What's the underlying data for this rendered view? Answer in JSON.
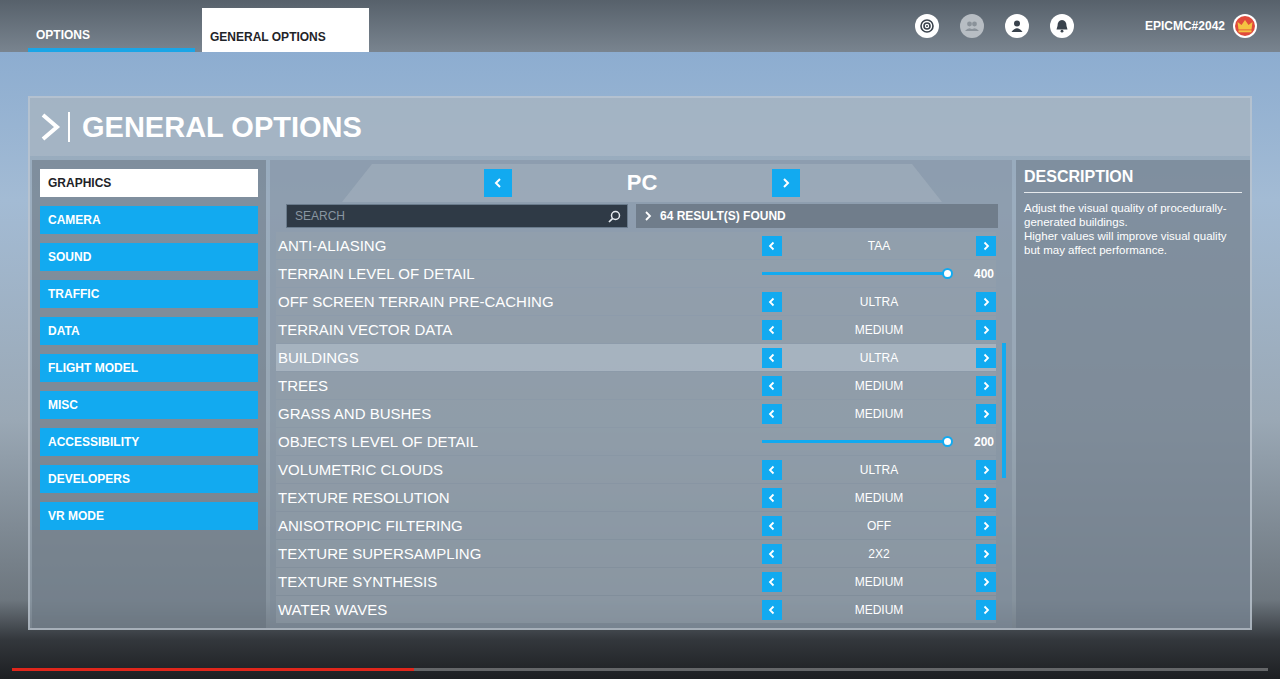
{
  "top_bar": {
    "tabs": [
      {
        "label": "OPTIONS",
        "selected": false
      },
      {
        "label": "GENERAL OPTIONS",
        "selected": true
      }
    ],
    "icons": [
      {
        "disabled": false
      },
      {
        "disabled": true
      },
      {
        "disabled": false
      },
      {
        "disabled": false
      }
    ],
    "username": "EPICMC#2042"
  },
  "panel": {
    "title": "GENERAL OPTIONS"
  },
  "sidebar": {
    "items": [
      {
        "label": "GRAPHICS",
        "selected": true
      },
      {
        "label": "CAMERA",
        "selected": false
      },
      {
        "label": "SOUND",
        "selected": false
      },
      {
        "label": "TRAFFIC",
        "selected": false
      },
      {
        "label": "DATA",
        "selected": false
      },
      {
        "label": "FLIGHT MODEL",
        "selected": false
      },
      {
        "label": "MISC",
        "selected": false
      },
      {
        "label": "ACCESSIBILITY",
        "selected": false
      },
      {
        "label": "DEVELOPERS",
        "selected": false
      },
      {
        "label": "VR MODE",
        "selected": false
      }
    ]
  },
  "platform": {
    "label": "PC"
  },
  "search": {
    "placeholder": "SEARCH",
    "results": "64 RESULT(S) FOUND"
  },
  "settings": [
    {
      "label": "ANTI-ALIASING",
      "kind": "select",
      "value": "TAA",
      "selected": false
    },
    {
      "label": "TERRAIN LEVEL OF DETAIL",
      "kind": "slider",
      "level": 1,
      "value": "400",
      "selected": false
    },
    {
      "label": "OFF SCREEN TERRAIN PRE-CACHING",
      "kind": "select",
      "value": "ULTRA",
      "selected": false
    },
    {
      "label": "TERRAIN VECTOR DATA",
      "kind": "select",
      "value": "MEDIUM",
      "selected": false
    },
    {
      "label": "BUILDINGS",
      "kind": "select",
      "value": "ULTRA",
      "selected": true
    },
    {
      "label": "TREES",
      "kind": "select",
      "value": "MEDIUM",
      "selected": false
    },
    {
      "label": "GRASS AND BUSHES",
      "kind": "select",
      "value": "MEDIUM",
      "selected": false
    },
    {
      "label": "OBJECTS LEVEL OF DETAIL",
      "kind": "slider",
      "level": 1,
      "value": "200",
      "selected": false
    },
    {
      "label": "VOLUMETRIC CLOUDS",
      "kind": "select",
      "value": "ULTRA",
      "selected": false
    },
    {
      "label": "TEXTURE RESOLUTION",
      "kind": "select",
      "value": "MEDIUM",
      "selected": false
    },
    {
      "label": "ANISOTROPIC FILTERING",
      "kind": "select",
      "value": "OFF",
      "selected": false
    },
    {
      "label": "TEXTURE SUPERSAMPLING",
      "kind": "select",
      "value": "2X2",
      "selected": false
    },
    {
      "label": "TEXTURE SYNTHESIS",
      "kind": "select",
      "value": "MEDIUM",
      "selected": false
    },
    {
      "label": "WATER WAVES",
      "kind": "select",
      "value": "MEDIUM",
      "selected": false
    }
  ],
  "scrollbar": {
    "start": 0.28,
    "size": 0.34
  },
  "description": {
    "title": "DESCRIPTION",
    "paragraphs": [
      "Adjust the visual quality of procedurally-generated buildings.",
      "Higher values will improve visual quality but may affect performance."
    ]
  },
  "video": {
    "progress": 0.32
  }
}
